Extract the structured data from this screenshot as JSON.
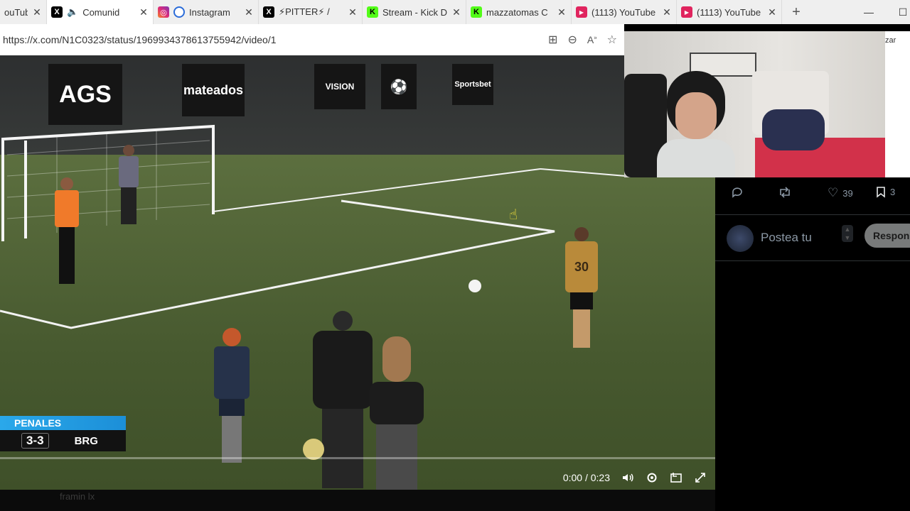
{
  "tabs": [
    {
      "title": "ouTube",
      "favicon": "youtube-icon",
      "active": false
    },
    {
      "title": "Comunid",
      "favicon": "x-icon",
      "active": true,
      "audio": true
    },
    {
      "title": "Instagram",
      "favicon": "instagram-icon",
      "active": false
    },
    {
      "title": "⚡PITTER⚡ /",
      "favicon": "x-icon",
      "active": false
    },
    {
      "title": "Stream - Kick D",
      "favicon": "kick-icon",
      "active": false
    },
    {
      "title": "mazzatomas C",
      "favicon": "kick-icon",
      "active": false
    },
    {
      "title": "(1113) YouTube",
      "favicon": "youtube-icon",
      "active": false
    },
    {
      "title": "(1113) YouTube",
      "favicon": "youtube-icon",
      "active": false
    }
  ],
  "address": {
    "url": "https://x.com/N1C0323/status/1969934378613755942/video/1",
    "partial_right_text": "zar"
  },
  "video": {
    "banners": [
      "AGS",
      "mateados",
      "VISION",
      "Sportsbet"
    ],
    "time": "0:00 / 0:23",
    "progress_fraction": 0.0,
    "scoreboard": {
      "label": "PENALES",
      "score": "3-3",
      "team": "BRG"
    },
    "jersey_number": "30"
  },
  "tweet_actions": {
    "likes": "39",
    "bookmarks": "3"
  },
  "reply": {
    "placeholder": "Postea tu",
    "button": "Respon"
  },
  "bottom": {
    "faded_text": "framin lx"
  },
  "colors": {
    "scoreboard_blue": "#2aa8ea",
    "x_dark": "#000000",
    "youtube_red": "#e0245e",
    "kick_green": "#53fc18"
  }
}
